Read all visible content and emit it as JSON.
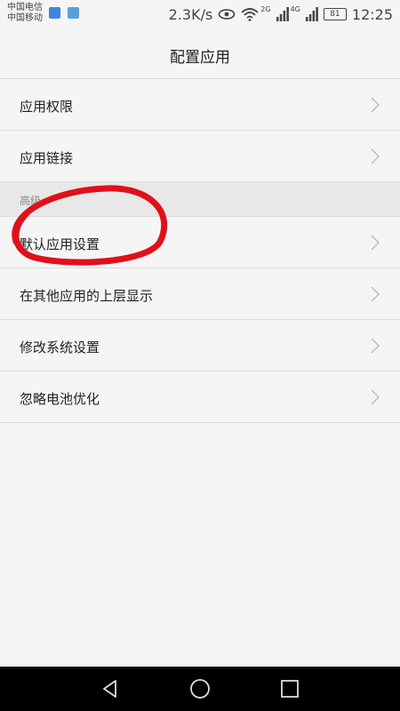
{
  "status_bar": {
    "carrier_1": "中国电信",
    "carrier_2": "中国移动",
    "net_speed": "2.3K/s",
    "net_badge_1": "2G",
    "net_badge_2": "4G",
    "battery": "81",
    "time": "12:25"
  },
  "header": {
    "title": "配置应用"
  },
  "list": {
    "items_top": [
      {
        "label": "应用权限"
      },
      {
        "label": "应用链接"
      }
    ],
    "section_label": "高级",
    "items_advanced": [
      {
        "label": "默认应用设置"
      },
      {
        "label": "在其他应用的上层显示"
      },
      {
        "label": "修改系统设置"
      },
      {
        "label": "忽略电池优化"
      }
    ]
  },
  "colors": {
    "background": "#f5f5f5",
    "section_background": "#e8e8e8",
    "annotation_red": "#e0101a",
    "nav_bar": "#000000"
  },
  "icons": {
    "chevron": "chevron-right-icon",
    "back": "nav-back-icon",
    "home": "nav-home-icon",
    "recents": "nav-recents-icon"
  }
}
